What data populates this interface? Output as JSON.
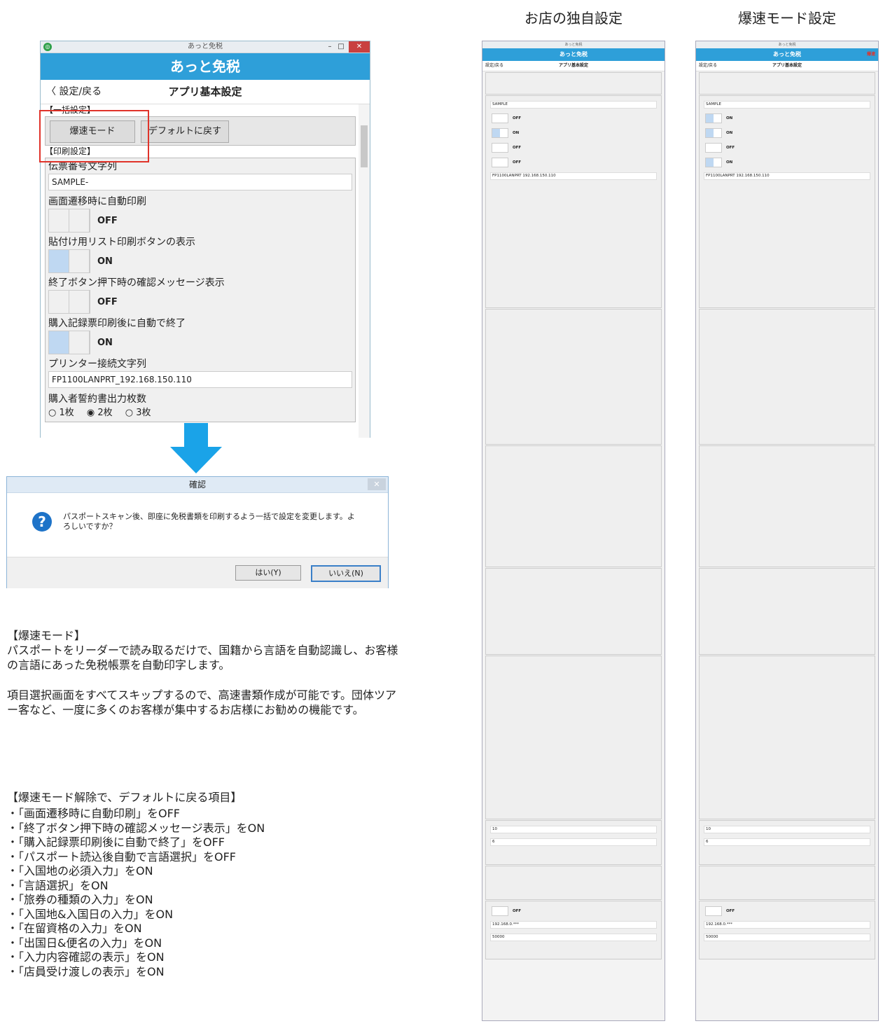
{
  "window": {
    "title": "あっと免税",
    "app_logo": "あっと免税",
    "back_label": "設定/戻る",
    "page_title": "アプリ基本設定",
    "minimize": "–",
    "maximize": "□",
    "close": "✕",
    "section_bulk": "【一括設定】",
    "btn_speed": "爆速モード",
    "btn_default": "デフォルトに戻す",
    "section_print": "【印刷設定】",
    "slip_label": "伝票番号文字列",
    "slip_value": "SAMPLE-",
    "auto_print_label": "画面遷移時に自動印刷",
    "auto_print_state": "OFF",
    "paste_list_label": "貼付け用リスト印刷ボタンの表示",
    "paste_list_state": "ON",
    "exit_confirm_label": "終了ボタン押下時の確認メッセージ表示",
    "exit_confirm_state": "OFF",
    "auto_exit_label": "購入記録票印刷後に自動で終了",
    "auto_exit_state": "ON",
    "printer_label": "プリンター接続文字列",
    "printer_value": "FP1100LANPRT_192.168.150.110",
    "copies_label": "購入者誓約書出力枚数",
    "copies_opt1": "○ 1枚",
    "copies_opt2": "◉ 2枚",
    "copies_opt3": "○ 3枚"
  },
  "dialog": {
    "title": "確認",
    "message": "パスポートスキャン後、即座に免税書類を印刷するよう一括で設定を変更します。よろしいですか？",
    "yes": "はい(Y)",
    "no": "いいえ(N)",
    "close": "✕",
    "icon": "?"
  },
  "description": {
    "heading": "【爆速モード】",
    "p1": "パスポートをリーダーで読み取るだけで、国籍から言語を自動認識し、お客様の言語にあった免税帳票を自動印字します。",
    "p2": "項目選択画面をすべてスキップするので、高速書類作成が可能です。団体ツアー客など、一度に多くのお客様が集中するお店様にお勧めの機能です。"
  },
  "reset_list": {
    "heading": "【爆速モード解除で、デフォルトに戻る項目】",
    "items": [
      "・「画面遷移時に自動印刷」をOFF",
      "・「終了ボタン押下時の確認メッセージ表示」をON",
      "・「購入記録票印刷後に自動で終了」をOFF",
      "・「パスポート読込後自動で言語選択」をOFF",
      "・「入国地の必須入力」をON",
      "・「言語選択」をON",
      "・「旅券の種類の入力」をON",
      "・「入国地&入国日の入力」をON",
      "・「在留資格の入力」をON",
      "・「出国日&便名の入力」をON",
      "・「入力内容確認の表示」をON",
      "・「店員受け渡しの表示」をON"
    ]
  },
  "right": {
    "title_left": "お店の独自設定",
    "title_right": "爆速モード設定",
    "mini_title": "あっと免税",
    "mini_logo": "あっと免税",
    "mini_back": "設定/戻る",
    "mini_page": "アプリ基本設定",
    "mini_badge": "爆速",
    "slip": "SAMPLE",
    "printer": "FP1100LANPRT 192.168.150.110",
    "ip": "192.168.0.***",
    "port": "50000",
    "years": "10",
    "months": "6",
    "zero": "0"
  },
  "colors": {
    "accent": "#2e9fd9",
    "highlight": "#e0332a",
    "arrow": "#1aa3e8"
  }
}
